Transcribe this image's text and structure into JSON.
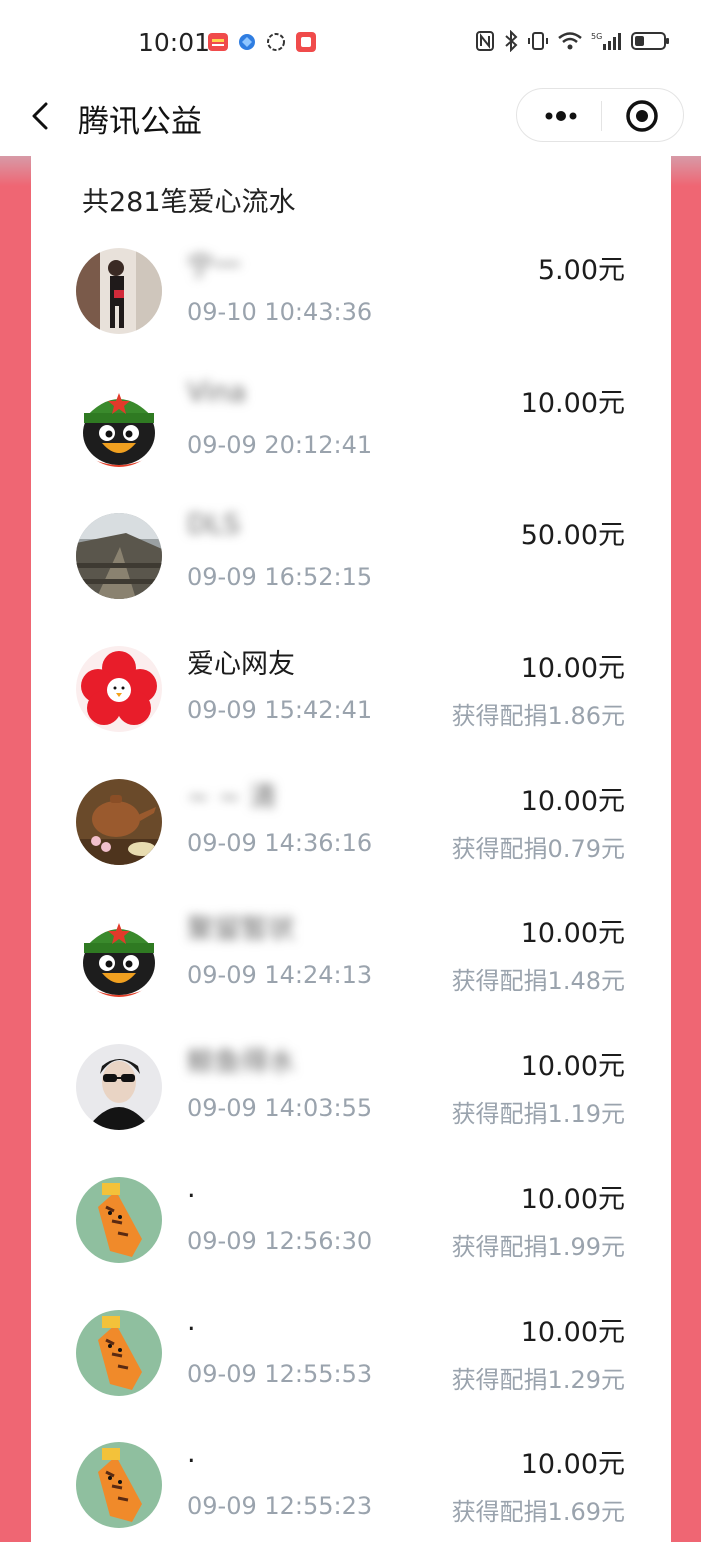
{
  "status_bar": {
    "time": "10:01",
    "left_icons": [
      "message-app-icon",
      "browser-app-icon",
      "ring-app-icon",
      "notes-app-icon"
    ],
    "right_icons": [
      "nfc-icon",
      "bluetooth-icon",
      "vibrate-icon",
      "wifi-icon",
      "signal-5g-icon",
      "battery-icon"
    ]
  },
  "nav": {
    "title": "腾讯公益",
    "back_icon": "chevron-left-icon",
    "more_icon": "more-dots-icon",
    "close_icon": "target-close-icon"
  },
  "colors": {
    "accent": "#ef6673",
    "muted_text": "#9aa3ad"
  },
  "list": {
    "header": "共281笔爱心流水",
    "items": [
      {
        "name": "宁一",
        "time": "09-10 10:43:36",
        "amount": "5.00元",
        "match": "",
        "avatar": "photo-portrait"
      },
      {
        "name": "Vina",
        "time": "09-09 20:12:41",
        "amount": "10.00元",
        "match": "",
        "avatar": "qq-penguin"
      },
      {
        "name": "DLS",
        "time": "09-09 16:52:15",
        "amount": "50.00元",
        "match": "",
        "avatar": "photo-great-wall"
      },
      {
        "name": "爱心网友",
        "time": "09-09 15:42:41",
        "amount": "10.00元",
        "match": "获得配捐1.86元",
        "avatar": "red-flower"
      },
      {
        "name": "~ ~ 清",
        "time": "09-09 14:36:16",
        "amount": "10.00元",
        "match": "获得配捐0.79元",
        "avatar": "photo-teapot"
      },
      {
        "name": "聚留暂状",
        "time": "09-09 14:24:13",
        "amount": "10.00元",
        "match": "获得配捐1.48元",
        "avatar": "qq-penguin"
      },
      {
        "name": "鲸鱼得水",
        "time": "09-09 14:03:55",
        "amount": "10.00元",
        "match": "获得配捐1.19元",
        "avatar": "photo-person-sunglasses"
      },
      {
        "name": ".",
        "time": "09-09 12:56:30",
        "amount": "10.00元",
        "match": "获得配捐1.99元",
        "avatar": "tiger-cartoon"
      },
      {
        "name": ".",
        "time": "09-09 12:55:53",
        "amount": "10.00元",
        "match": "获得配捐1.29元",
        "avatar": "tiger-cartoon"
      },
      {
        "name": ".",
        "time": "09-09 12:55:23",
        "amount": "10.00元",
        "match": "获得配捐1.69元",
        "avatar": "tiger-cartoon"
      }
    ]
  }
}
